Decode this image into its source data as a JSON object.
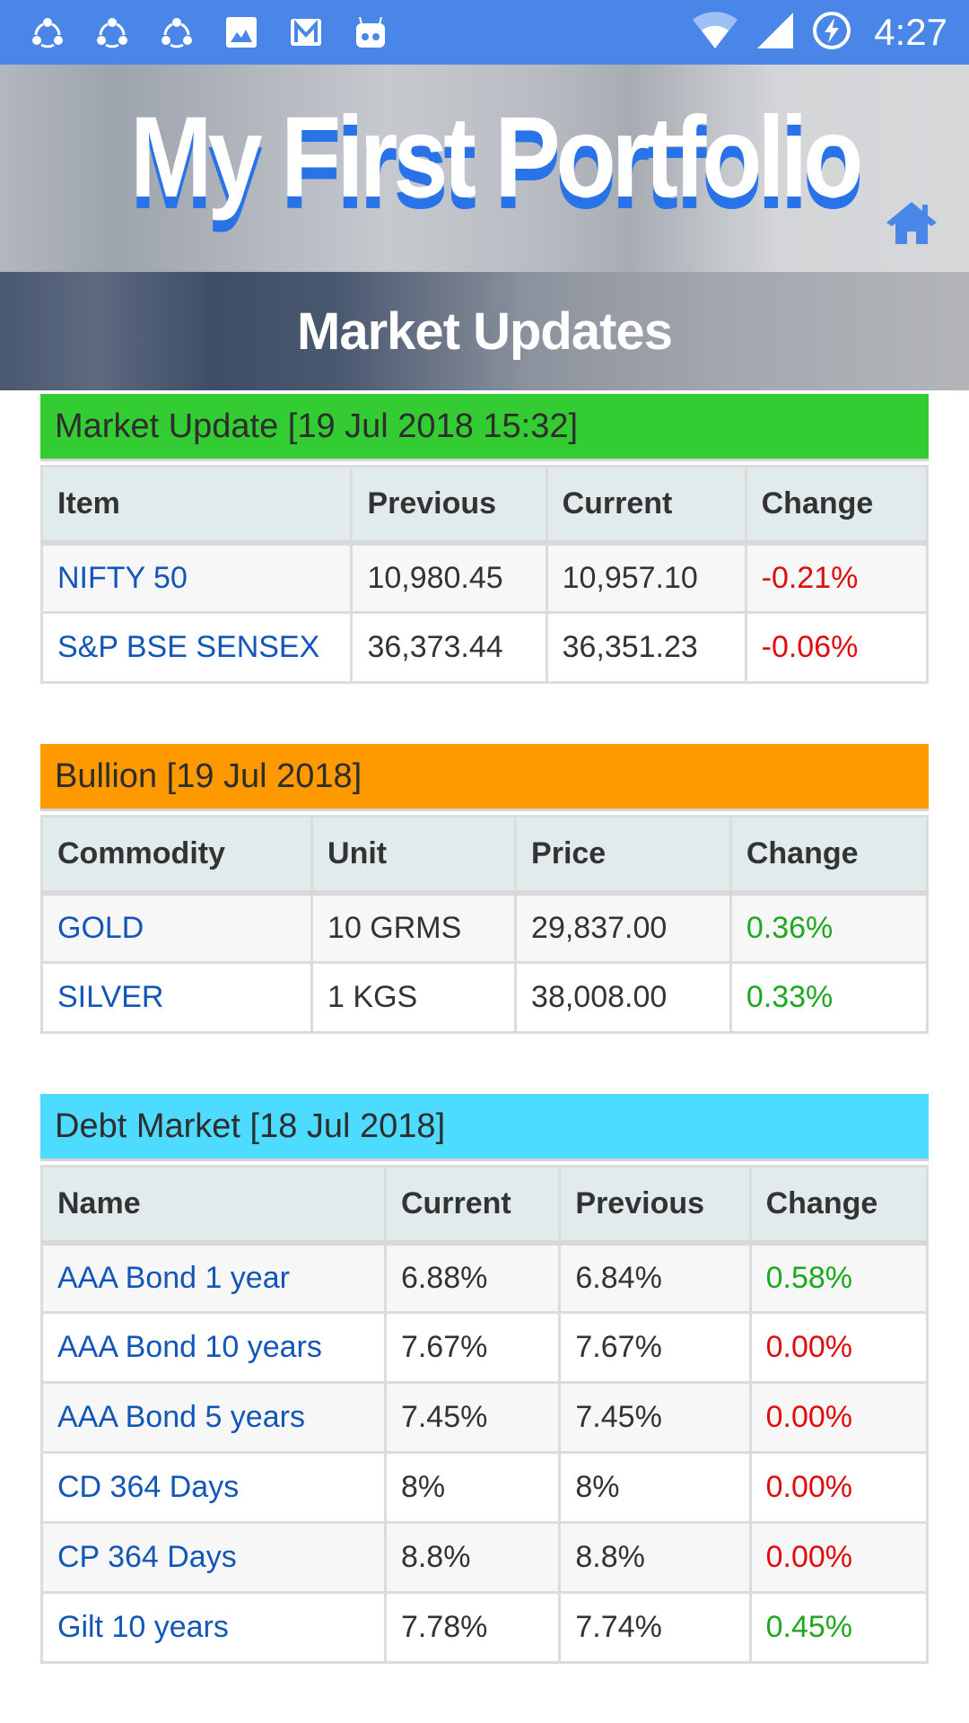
{
  "status_bar": {
    "time": "4:27",
    "left_icons": [
      "shareit-icon",
      "shareit-icon",
      "shareit-icon",
      "image-icon",
      "gmail-icon",
      "android-bot-icon"
    ],
    "right_icons": [
      "wifi-icon",
      "signal-icon",
      "battery-charging-icon"
    ]
  },
  "header": {
    "app_title": "My First Portfolio",
    "home_icon": "home-icon",
    "page_title": "Market Updates"
  },
  "colors": {
    "status_bar": "#4a86e8",
    "market_update_header": "#33cc33",
    "bullion_header": "#ff9900",
    "debt_header": "#4ddbff",
    "link": "#1256b8",
    "negative": "#e00d0d",
    "positive": "#1ea81e"
  },
  "market_update": {
    "title": "Market Update [19 Jul 2018 15:32]",
    "columns": [
      "Item",
      "Previous",
      "Current",
      "Change"
    ],
    "rows": [
      {
        "item": "NIFTY 50",
        "previous": "10,980.45",
        "current": "10,957.10",
        "change": "-0.21%",
        "trend": "neg"
      },
      {
        "item": "S&P BSE SENSEX",
        "previous": "36,373.44",
        "current": "36,351.23",
        "change": "-0.06%",
        "trend": "neg"
      }
    ]
  },
  "bullion": {
    "title": "Bullion [19 Jul 2018]",
    "columns": [
      "Commodity",
      "Unit",
      "Price",
      "Change"
    ],
    "rows": [
      {
        "item": "GOLD",
        "unit": "10 GRMS",
        "price": "29,837.00",
        "change": "0.36%",
        "trend": "pos"
      },
      {
        "item": "SILVER",
        "unit": "1 KGS",
        "price": "38,008.00",
        "change": "0.33%",
        "trend": "pos"
      }
    ]
  },
  "debt_market": {
    "title": "Debt Market [18 Jul 2018]",
    "columns": [
      "Name",
      "Current",
      "Previous",
      "Change"
    ],
    "rows": [
      {
        "item": "AAA Bond 1 year",
        "current": "6.88%",
        "previous": "6.84%",
        "change": "0.58%",
        "trend": "pos"
      },
      {
        "item": "AAA Bond 10 years",
        "current": "7.67%",
        "previous": "7.67%",
        "change": "0.00%",
        "trend": "neg"
      },
      {
        "item": "AAA Bond 5 years",
        "current": "7.45%",
        "previous": "7.45%",
        "change": "0.00%",
        "trend": "neg"
      },
      {
        "item": "CD 364 Days",
        "current": "8%",
        "previous": "8%",
        "change": "0.00%",
        "trend": "neg"
      },
      {
        "item": "CP 364 Days",
        "current": "8.8%",
        "previous": "8.8%",
        "change": "0.00%",
        "trend": "neg"
      },
      {
        "item": "Gilt 10 years",
        "current": "7.78%",
        "previous": "7.74%",
        "change": "0.45%",
        "trend": "pos"
      }
    ]
  }
}
